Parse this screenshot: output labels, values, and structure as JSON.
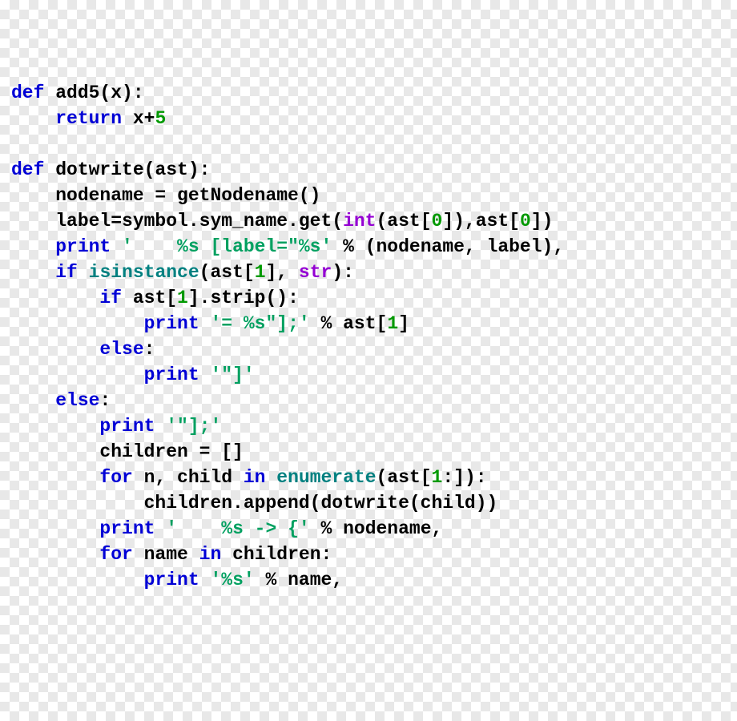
{
  "code": {
    "lines": [
      [
        {
          "cls": "kw",
          "t": "def"
        },
        {
          "cls": "nm",
          "t": " add5(x):"
        }
      ],
      [
        {
          "cls": "nm",
          "t": "    "
        },
        {
          "cls": "kw",
          "t": "return"
        },
        {
          "cls": "nm",
          "t": " x+"
        },
        {
          "cls": "num",
          "t": "5"
        }
      ],
      [],
      [
        {
          "cls": "kw",
          "t": "def"
        },
        {
          "cls": "nm",
          "t": " dotwrite(ast):"
        }
      ],
      [
        {
          "cls": "nm",
          "t": "    nodename = getNodename()"
        }
      ],
      [
        {
          "cls": "nm",
          "t": "    label=symbol.sym_name.get("
        },
        {
          "cls": "fn",
          "t": "int"
        },
        {
          "cls": "nm",
          "t": "(ast["
        },
        {
          "cls": "num",
          "t": "0"
        },
        {
          "cls": "nm",
          "t": "]),ast["
        },
        {
          "cls": "num",
          "t": "0"
        },
        {
          "cls": "nm",
          "t": "])"
        }
      ],
      [
        {
          "cls": "nm",
          "t": "    "
        },
        {
          "cls": "kw",
          "t": "print"
        },
        {
          "cls": "nm",
          "t": " "
        },
        {
          "cls": "str",
          "t": "'    %s [label=\"%s'"
        },
        {
          "cls": "nm",
          "t": " % (nodename, label),"
        }
      ],
      [
        {
          "cls": "nm",
          "t": "    "
        },
        {
          "cls": "kw",
          "t": "if"
        },
        {
          "cls": "nm",
          "t": " "
        },
        {
          "cls": "bi",
          "t": "isinstance"
        },
        {
          "cls": "nm",
          "t": "(ast["
        },
        {
          "cls": "num",
          "t": "1"
        },
        {
          "cls": "nm",
          "t": "], "
        },
        {
          "cls": "fn",
          "t": "str"
        },
        {
          "cls": "nm",
          "t": "):"
        }
      ],
      [
        {
          "cls": "nm",
          "t": "        "
        },
        {
          "cls": "kw",
          "t": "if"
        },
        {
          "cls": "nm",
          "t": " ast["
        },
        {
          "cls": "num",
          "t": "1"
        },
        {
          "cls": "nm",
          "t": "].strip():"
        }
      ],
      [
        {
          "cls": "nm",
          "t": "            "
        },
        {
          "cls": "kw",
          "t": "print"
        },
        {
          "cls": "nm",
          "t": " "
        },
        {
          "cls": "str",
          "t": "'= %s\"];'"
        },
        {
          "cls": "nm",
          "t": " % ast["
        },
        {
          "cls": "num",
          "t": "1"
        },
        {
          "cls": "nm",
          "t": "]"
        }
      ],
      [
        {
          "cls": "nm",
          "t": "        "
        },
        {
          "cls": "kw",
          "t": "else"
        },
        {
          "cls": "nm",
          "t": ":"
        }
      ],
      [
        {
          "cls": "nm",
          "t": "            "
        },
        {
          "cls": "kw",
          "t": "print"
        },
        {
          "cls": "nm",
          "t": " "
        },
        {
          "cls": "str",
          "t": "'\"]'"
        }
      ],
      [
        {
          "cls": "nm",
          "t": "    "
        },
        {
          "cls": "kw",
          "t": "else"
        },
        {
          "cls": "nm",
          "t": ":"
        }
      ],
      [
        {
          "cls": "nm",
          "t": "        "
        },
        {
          "cls": "kw",
          "t": "print"
        },
        {
          "cls": "nm",
          "t": " "
        },
        {
          "cls": "str",
          "t": "'\"];'"
        }
      ],
      [
        {
          "cls": "nm",
          "t": "        children = []"
        }
      ],
      [
        {
          "cls": "nm",
          "t": "        "
        },
        {
          "cls": "kw",
          "t": "for"
        },
        {
          "cls": "nm",
          "t": " n, child "
        },
        {
          "cls": "kw",
          "t": "in"
        },
        {
          "cls": "nm",
          "t": " "
        },
        {
          "cls": "bi",
          "t": "enumerate"
        },
        {
          "cls": "nm",
          "t": "(ast["
        },
        {
          "cls": "num",
          "t": "1"
        },
        {
          "cls": "nm",
          "t": ":]):"
        }
      ],
      [
        {
          "cls": "nm",
          "t": "            children.append(dotwrite(child))"
        }
      ],
      [
        {
          "cls": "nm",
          "t": "        "
        },
        {
          "cls": "kw",
          "t": "print"
        },
        {
          "cls": "nm",
          "t": " "
        },
        {
          "cls": "str",
          "t": "'    %s -> {'"
        },
        {
          "cls": "nm",
          "t": " % nodename,"
        }
      ],
      [
        {
          "cls": "nm",
          "t": "        "
        },
        {
          "cls": "kw",
          "t": "for"
        },
        {
          "cls": "nm",
          "t": " name "
        },
        {
          "cls": "kw",
          "t": "in"
        },
        {
          "cls": "nm",
          "t": " children:"
        }
      ],
      [
        {
          "cls": "nm",
          "t": "            "
        },
        {
          "cls": "kw",
          "t": "print"
        },
        {
          "cls": "nm",
          "t": " "
        },
        {
          "cls": "str",
          "t": "'%s'"
        },
        {
          "cls": "nm",
          "t": " % name,"
        }
      ]
    ]
  }
}
